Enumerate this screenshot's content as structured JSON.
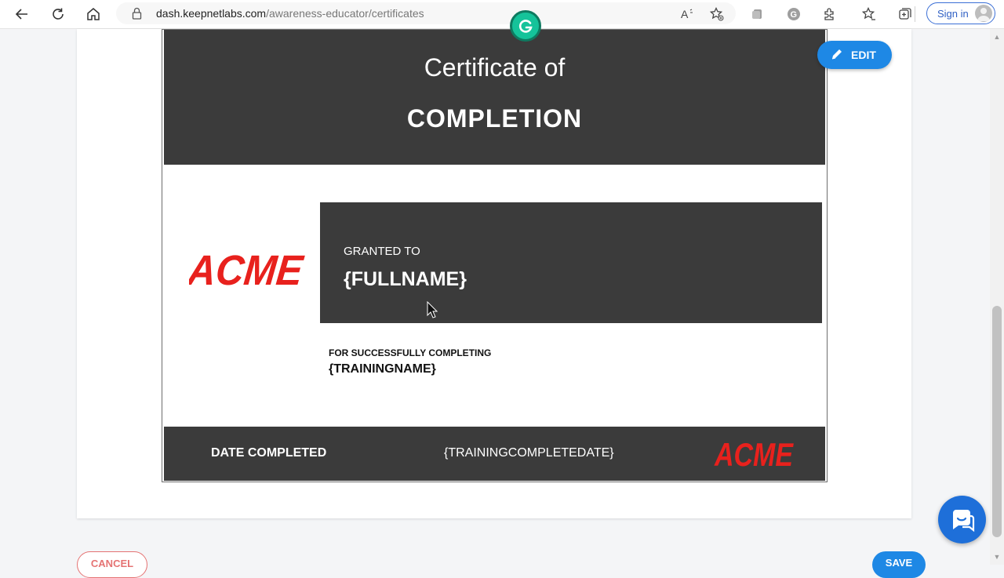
{
  "browser": {
    "url_host": "dash.keepnetlabs.com",
    "url_path": "/awareness-educator/certificates",
    "signin_label": "Sign in",
    "icons": [
      "back-icon",
      "refresh-icon",
      "home-icon",
      "lock-icon",
      "read-aloud-icon",
      "add-favorite-icon",
      "extensions-icon",
      "grammarly-icon",
      "puzzle-icon",
      "favorites-icon",
      "collections-icon"
    ]
  },
  "certificate": {
    "title_line1": "Certificate of",
    "title_line2": "COMPLETION",
    "granted_label": "GRANTED TO",
    "fullname_placeholder": "{FULLNAME}",
    "for_label": "FOR SUCCESSFULLY COMPLETING",
    "training_placeholder": "{TRAININGNAME}",
    "date_label": "DATE COMPLETED",
    "date_placeholder": "{TRAININGCOMPLETEDATE}",
    "logo_text": "ACME",
    "logo_color": "#e8211d",
    "dark_color": "#3b3b3b"
  },
  "actions": {
    "edit_label": "EDIT",
    "cancel_label": "CANCEL",
    "save_label": "SAVE",
    "accent_color": "#1e88e5"
  }
}
